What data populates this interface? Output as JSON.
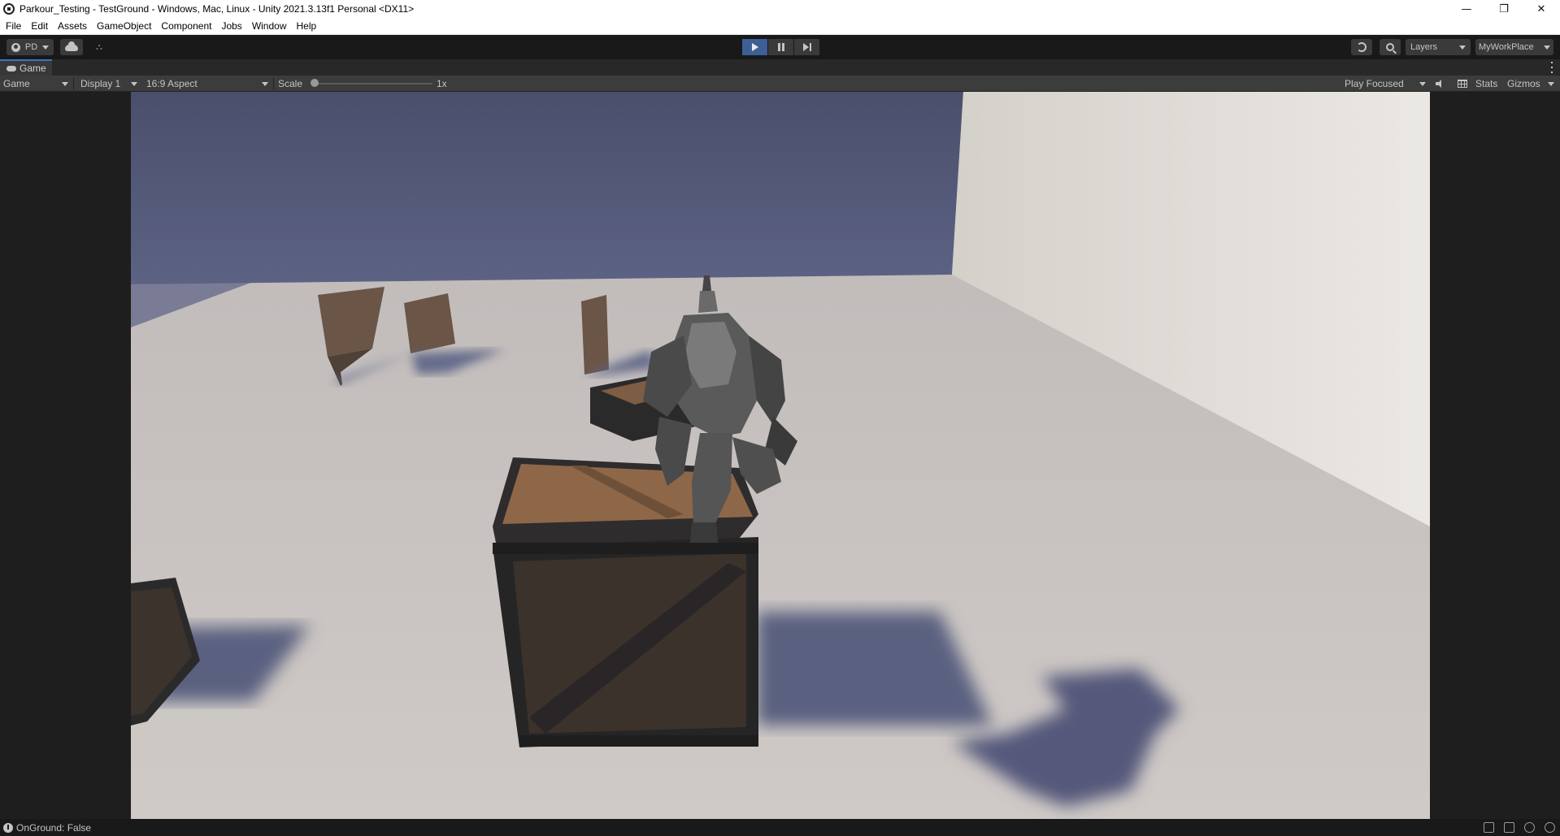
{
  "window": {
    "title": "Parkour_Testing - TestGround - Windows, Mac, Linux - Unity 2021.3.13f1 Personal <DX11>",
    "controls": {
      "minimize": "—",
      "restore": "❐",
      "close": "✕"
    }
  },
  "menu": {
    "items": [
      "File",
      "Edit",
      "Assets",
      "GameObject",
      "Component",
      "Jobs",
      "Window",
      "Help"
    ]
  },
  "toolbar": {
    "account_label": "PD",
    "layers_label": "Layers",
    "layout_label": "MyWorkPlace",
    "play_state": "playing"
  },
  "tab": {
    "label": "Game"
  },
  "game_toolbar": {
    "view_mode": "Game",
    "display": "Display 1",
    "aspect": "16:9 Aspect",
    "scale_label": "Scale",
    "scale_value": "1x",
    "play_mode": "Play Focused",
    "stats_label": "Stats",
    "gizmos_label": "Gizmos"
  },
  "status": {
    "message": "OnGround: False"
  },
  "colors": {
    "play_active": "#3e5f96",
    "wall_back": "#565c7b",
    "wall_right": "#ddd9d3",
    "floor": "#c7c2be",
    "crate_frame": "#2b2a2b",
    "crate_wood": "#8a6446"
  }
}
